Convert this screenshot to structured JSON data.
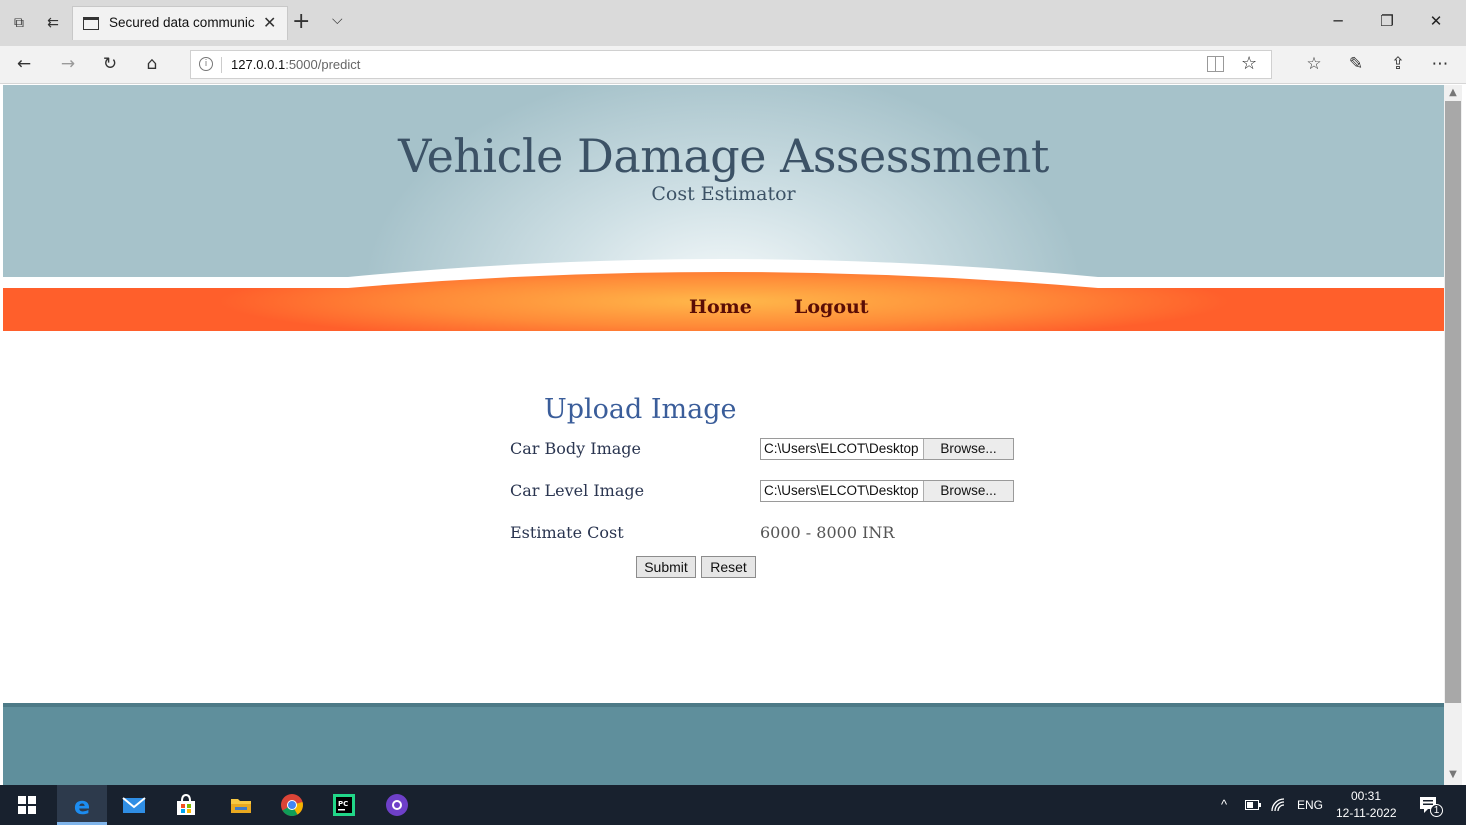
{
  "browser": {
    "tab_title": "Secured data communic",
    "url_host": "127.0.0.1",
    "url_path": ":5000/predict"
  },
  "header": {
    "title": "Vehicle Damage Assessment",
    "subtitle": "Cost Estimator"
  },
  "menu": {
    "home": "Home",
    "logout": "Logout"
  },
  "form": {
    "heading": "Upload Image",
    "car_body_label": "Car Body Image",
    "car_body_value": "C:\\Users\\ELCOT\\Desktop",
    "car_level_label": "Car Level Image",
    "car_level_value": "C:\\Users\\ELCOT\\Desktop",
    "browse_label": "Browse...",
    "estimate_label": "Estimate Cost",
    "estimate_value": "6000 - 8000 INR",
    "submit_label": "Submit",
    "reset_label": "Reset"
  },
  "taskbar": {
    "language": "ENG",
    "time": "00:31",
    "date": "12-11-2022",
    "notification_count": "1"
  },
  "colors": {
    "menu_orange": "#ff5f2b",
    "menu_glow": "#ffb84a",
    "header_teal": "#a6c2ca",
    "footer_teal": "#5f8f9c",
    "title_color": "#3c5266",
    "heading_blue": "#3a5d9a",
    "menu_text": "#5a0d06"
  },
  "icons": {
    "window": [
      "tab-preview-icon",
      "set-aside-tabs-icon",
      "page-icon",
      "close-icon",
      "plus-icon",
      "chevron-down-icon",
      "minimize-icon",
      "restore-icon",
      "close-window-icon"
    ],
    "nav": [
      "back-icon",
      "forward-icon",
      "refresh-icon",
      "home-icon",
      "info-icon",
      "reading-view-icon",
      "star-icon",
      "favorites-icon",
      "pen-icon",
      "share-icon",
      "more-icon"
    ],
    "taskbar": [
      "windows-start-icon",
      "edge-icon",
      "mail-icon",
      "store-icon",
      "file-explorer-icon",
      "chrome-icon",
      "pycharm-icon",
      "github-icon",
      "chevron-up-icon",
      "battery-icon",
      "wifi-icon",
      "notification-icon"
    ]
  }
}
